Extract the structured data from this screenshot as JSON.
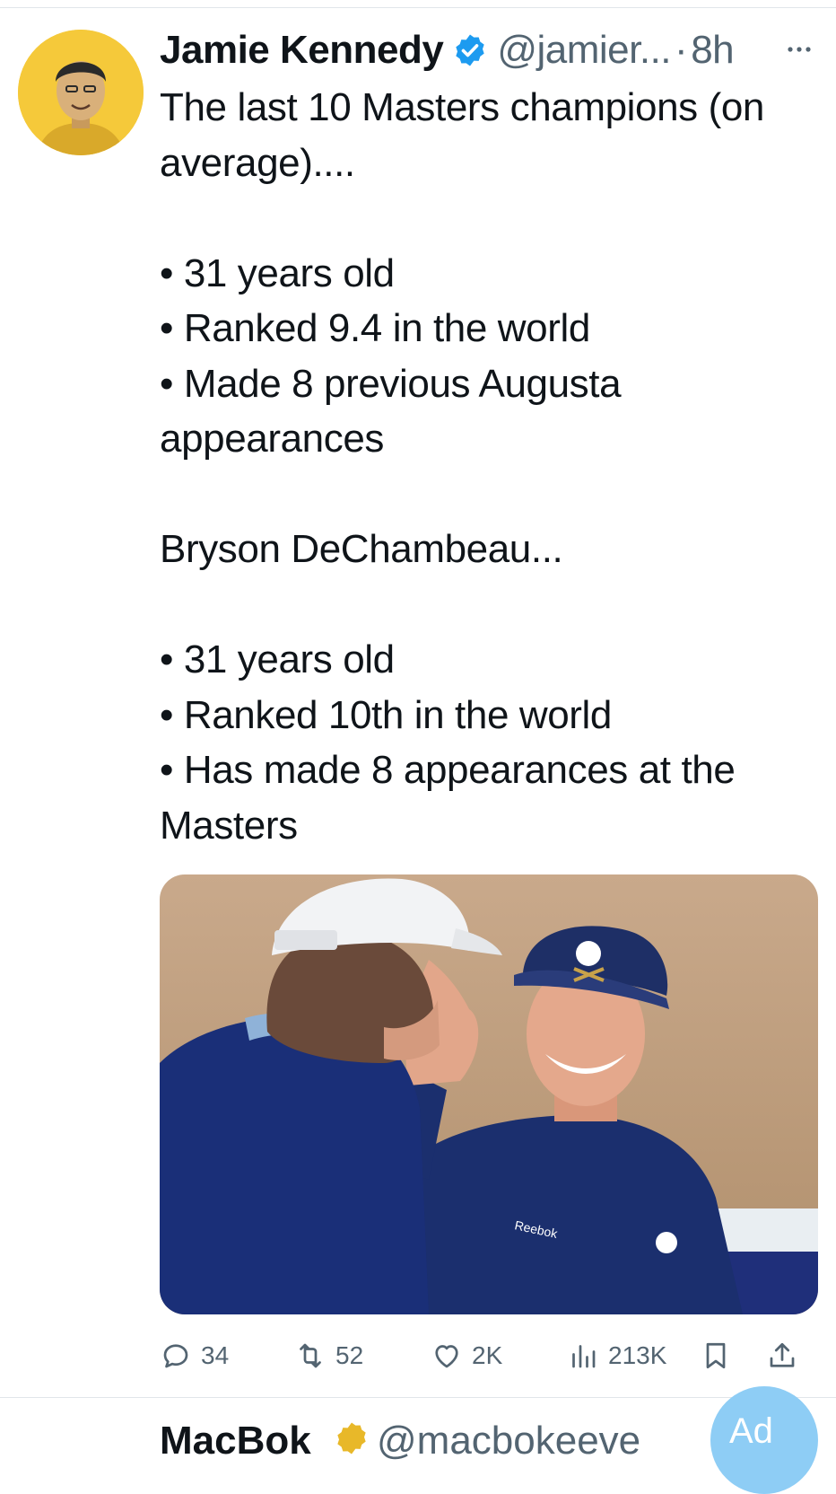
{
  "tweet": {
    "author_name": "Jamie Kennedy",
    "handle": "@jamier...",
    "separator": "·",
    "time": "8h",
    "text": "The last 10 Masters champions (on average)....\n\n• 31 years old\n• Ranked 9.4 in the world\n• Made 8 previous Augusta appearances\n\nBryson DeChambeau...\n\n• 31 years old\n• Ranked 10th in the world\n• Has made 8 appearances at the Masters"
  },
  "actions": {
    "replies": "34",
    "reposts": "52",
    "likes": "2K",
    "views": "213K"
  },
  "next_tweet": {
    "author_name": "MacBok",
    "handle": "@macbokeeve"
  },
  "fab": {
    "label": "Ad"
  },
  "colors": {
    "verified": "#1d9bf0",
    "secondary_text": "#536471",
    "avatar_bg": "#f5c93a",
    "fab_bg": "#8ecdf5"
  }
}
